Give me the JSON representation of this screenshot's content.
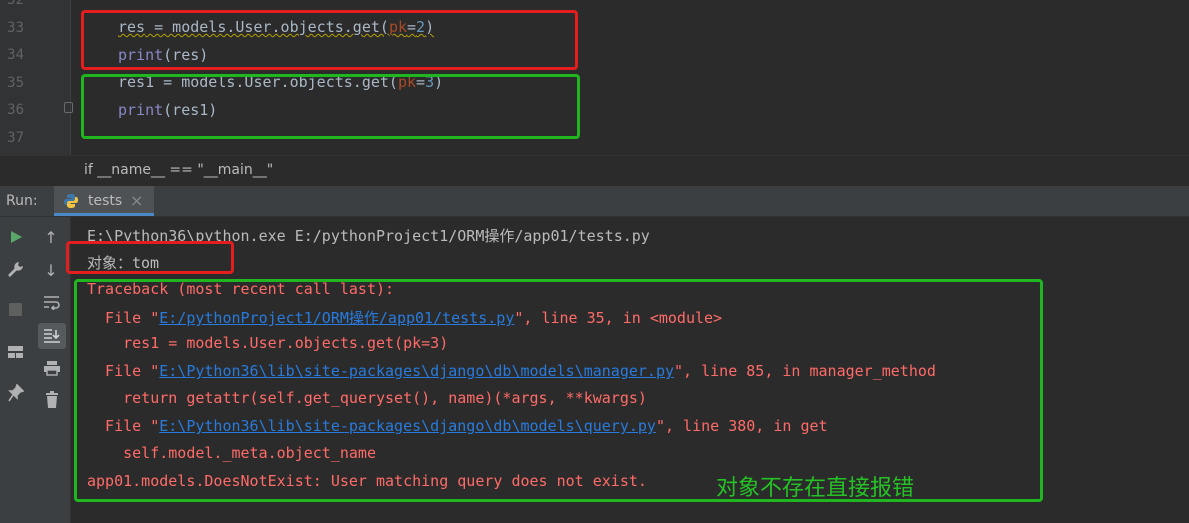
{
  "editor": {
    "line_numbers": [
      "32",
      "33",
      "34",
      "35",
      "36",
      "37"
    ],
    "lines": [
      {
        "name": "res",
        "call": " = models.User.objects.get(",
        "param": "pk",
        "eq": "=",
        "num": "2",
        "close": ")"
      },
      {
        "fn": "print",
        "args": "(res)"
      },
      {
        "name": "res1",
        "call": " = models.User.objects.get(",
        "param": "pk",
        "eq": "=",
        "num": "3",
        "close": ")"
      },
      {
        "fn": "print",
        "args": "(res1)"
      }
    ],
    "breadcrumb": "if __name__ == \"__main__\""
  },
  "run_panel": {
    "label": "Run:",
    "tab_label": "tests",
    "tab_close": "×"
  },
  "console": {
    "command": "E:\\Python36\\python.exe E:/pythonProject1/ORM操作/app01/tests.py",
    "output": "对象：tom",
    "traceback_header": "Traceback (most recent call last):",
    "frames": [
      {
        "prefix": "  File \"",
        "path": "E:/pythonProject1/ORM操作/app01/tests.py",
        "suffix": "\", line 35, in <module>",
        "code": "    res1 = models.User.objects.get(pk=3)"
      },
      {
        "prefix": "  File \"",
        "path": "E:\\Python36\\lib\\site-packages\\django\\db\\models\\manager.py",
        "suffix": "\", line 85, in manager_method",
        "code": "    return getattr(self.get_queryset(), name)(*args, **kwargs)"
      },
      {
        "prefix": "  File \"",
        "path": "E:\\Python36\\lib\\site-packages\\django\\db\\models\\query.py",
        "suffix": "\", line 380, in get",
        "code": "    self.model._meta.object_name"
      }
    ],
    "error": "app01.models.DoesNotExist: User matching query does not exist."
  },
  "annotation": "对象不存在直接报错",
  "colors": {
    "red_box": "#e41e1e",
    "green_box": "#1fb61f",
    "annotation": "#25c225"
  }
}
